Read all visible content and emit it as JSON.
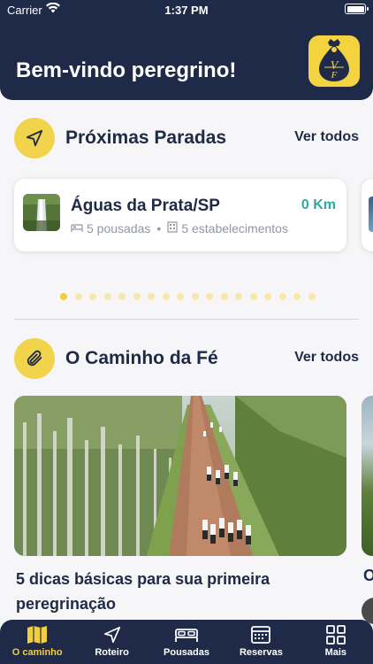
{
  "status_bar": {
    "carrier": "Carrier",
    "time": "1:37 PM"
  },
  "header": {
    "welcome": "Bem-vindo peregrino!",
    "logo_icon": "vf-logo-icon"
  },
  "section_stops": {
    "title": "Próximas Paradas",
    "link": "Ver todos",
    "icon": "navigation-arrow-icon"
  },
  "stop_card": {
    "name": "Águas da Prata/SP",
    "distance": "0 Km",
    "pousadas": "5 pousadas",
    "separator": "•",
    "estabelecimentos": "5 estabelecimentos"
  },
  "carousel": {
    "total": 18,
    "active": 0
  },
  "section_faith": {
    "title": "O Caminho da Fé",
    "link": "Ver todos",
    "icon": "paperclip-icon"
  },
  "article": {
    "title": "5 dicas básicas para sua primeira peregrinação",
    "peek_letter": "O"
  },
  "tabs": [
    {
      "label": "O caminho",
      "icon": "map-icon",
      "active": true
    },
    {
      "label": "Roteiro",
      "icon": "navigation-arrow-icon",
      "active": false
    },
    {
      "label": "Pousadas",
      "icon": "bed-icon",
      "active": false
    },
    {
      "label": "Reservas",
      "icon": "calendar-icon",
      "active": false
    },
    {
      "label": "Mais",
      "icon": "grid-icon",
      "active": false
    }
  ],
  "colors": {
    "header_bg": "#1e2a48",
    "accent_yellow": "#f2cd3c",
    "distance_teal": "#2ea9a2"
  }
}
